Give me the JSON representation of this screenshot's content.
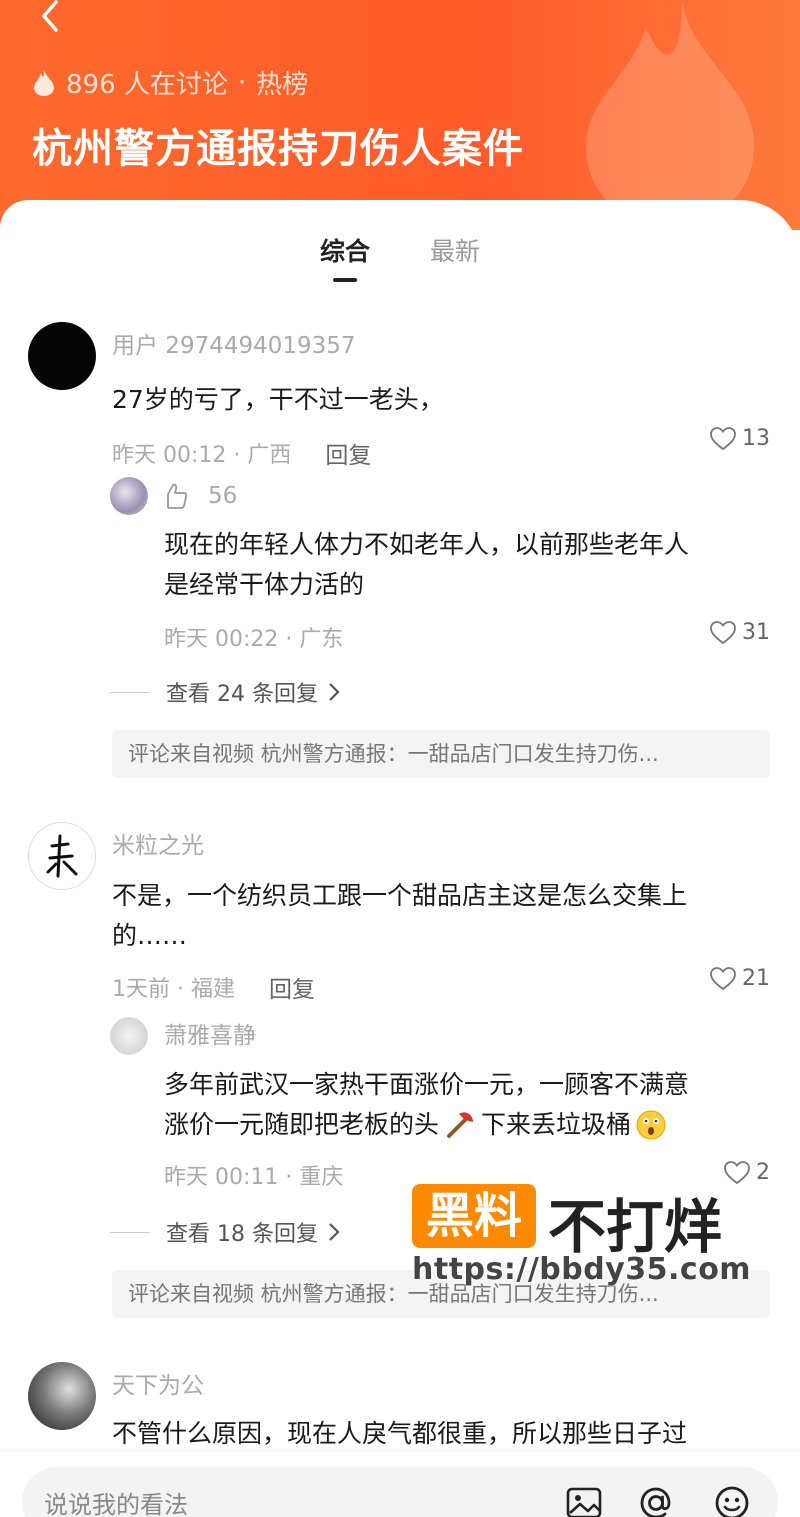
{
  "header": {
    "participants": "896 人在讨论",
    "separator": "·",
    "rank_label": "热榜",
    "title": "杭州警方通报持刀伤人案件"
  },
  "tabs": [
    {
      "label": "综合",
      "active": true
    },
    {
      "label": "最新",
      "active": false
    }
  ],
  "comments": [
    {
      "username": "用户 2974494019357",
      "text": "27岁的亏了，干不过一老头，",
      "time_location": "昨天 00:12 · 广西",
      "reply_label": "回复",
      "likes": "13",
      "sub_reply": {
        "badge_count": "56",
        "text_line1": "现在的年轻人体力不如老年人，以前那些老年人",
        "text_line2": "是经常干体力活的",
        "time_location": "昨天 00:22 · 广东",
        "likes": "31"
      },
      "view_more": "查看 24 条回复",
      "source": "评论来自视频 杭州警方通报：一甜品店门口发生持刀伤..."
    },
    {
      "username": "米粒之光",
      "text_line1": "不是，一个纺织员工跟一个甜品店主这是怎么交集上",
      "text_line2": "的……",
      "time_location": "1天前 · 福建",
      "reply_label": "回复",
      "likes": "21",
      "sub_reply": {
        "username": "萧雅喜静",
        "text_line1": "多年前武汉一家热干面涨价一元，一顾客不满意",
        "text_line2a": "涨价一元随即把老板的头",
        "text_line2b": "下来丢垃圾桶",
        "time_location": "昨天 00:11 · 重庆",
        "likes": "2"
      },
      "view_more": "查看 18 条回复",
      "source": "评论来自视频 杭州警方通报：一甜品店门口发生持刀伤..."
    },
    {
      "username": "天下为公",
      "text": "不管什么原因，现在人戾气都很重，所以那些日子过"
    }
  ],
  "watermark": {
    "box_text": "黑料",
    "text": "不打烊",
    "url": "https://bbdy35.com"
  },
  "input_bar": {
    "placeholder": "说说我的看法"
  },
  "colors": {
    "header_orange": "#ff5b2a",
    "watermark_orange": "#ff8a00"
  }
}
